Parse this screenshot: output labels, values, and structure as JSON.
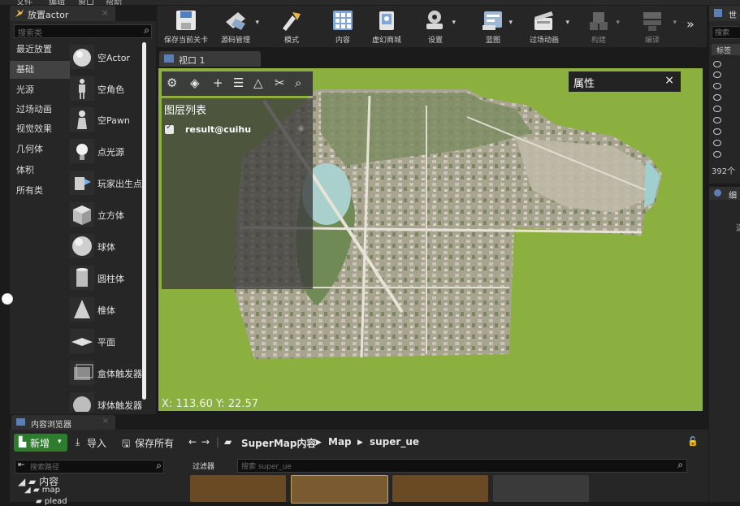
{
  "menu": [
    "文件",
    "编辑",
    "窗口",
    "帮助"
  ],
  "place_panel": {
    "tab_label": "放置actor",
    "search_placeholder": "搜索类",
    "categories": [
      {
        "label": "最近放置",
        "selected": false
      },
      {
        "label": "基础",
        "selected": true
      },
      {
        "label": "光源",
        "selected": false
      },
      {
        "label": "过场动画",
        "selected": false
      },
      {
        "label": "视觉效果",
        "selected": false
      },
      {
        "label": "几何体",
        "selected": false
      },
      {
        "label": "体积",
        "selected": false
      },
      {
        "label": "所有类",
        "selected": false
      }
    ],
    "items": [
      {
        "label": "空Actor",
        "icon": "sphere-icon"
      },
      {
        "label": "空角色",
        "icon": "character-icon"
      },
      {
        "label": "空Pawn",
        "icon": "pawn-icon"
      },
      {
        "label": "点光源",
        "icon": "point-light-icon"
      },
      {
        "label": "玩家出生点",
        "icon": "player-start-icon"
      },
      {
        "label": "立方体",
        "icon": "cube-icon"
      },
      {
        "label": "球体",
        "icon": "sphere-icon"
      },
      {
        "label": "圆柱体",
        "icon": "cylinder-icon"
      },
      {
        "label": "椎体",
        "icon": "cone-icon"
      },
      {
        "label": "平面",
        "icon": "plane-icon"
      },
      {
        "label": "盒体触发器",
        "icon": "box-trigger-icon"
      },
      {
        "label": "球体触发器",
        "icon": "sphere-trigger-icon"
      }
    ]
  },
  "toolbar": {
    "buttons": [
      {
        "label": "保存当前关卡",
        "icon": "save-icon",
        "dropdown": false
      },
      {
        "label": "源码管理",
        "icon": "source-control-icon",
        "dropdown": true
      },
      {
        "label": "模式",
        "icon": "modes-icon",
        "dropdown": false
      },
      {
        "label": "内容",
        "icon": "content-icon",
        "dropdown": false
      },
      {
        "label": "虚幻商城",
        "icon": "marketplace-icon",
        "dropdown": false
      },
      {
        "label": "设置",
        "icon": "settings-icon",
        "dropdown": true
      },
      {
        "label": "蓝图",
        "icon": "blueprint-icon",
        "dropdown": true
      },
      {
        "label": "过场动画",
        "icon": "cinematics-icon",
        "dropdown": true
      },
      {
        "label": "构建",
        "icon": "build-icon",
        "dropdown": true
      },
      {
        "label": "编译",
        "icon": "compile-icon",
        "dropdown": true
      }
    ],
    "overflow": "»"
  },
  "viewport": {
    "tab_label": "视口 1",
    "layer_panel_title": "图层列表",
    "layer_name": "result@cuihu",
    "layer_checked": true,
    "properties_title": "属性",
    "properties_close": "×",
    "coords_text": "X: 113.60   Y: 22.57",
    "tool_icons": [
      "gear-icon",
      "layers-icon",
      "plus-icon",
      "list-icon",
      "measure-area-icon",
      "scissors-icon",
      "search-icon"
    ]
  },
  "right_panel": {
    "tab_label": "世界",
    "search_placeholder": "搜索",
    "header_label": "标签",
    "count_text": "392个",
    "detail_tab_label": "细节",
    "detail_hint": "选"
  },
  "content_browser": {
    "tab_label": "内容浏览器",
    "new_label": "新增",
    "import_label": "导入",
    "save_all_label": "保存所有",
    "breadcrumb": [
      "SuperMap内容",
      "Map",
      "super_ue"
    ],
    "path_search_placeholder": "搜索路径",
    "filter_label": "过滤器",
    "asset_search_placeholder": "搜索 super_ue",
    "tree": [
      "内容",
      "map",
      "plead"
    ]
  },
  "colors": {
    "viewport_green": "#8bb040",
    "new_button": "#2e7d2e",
    "accent_blue": "#5b7fb4"
  }
}
